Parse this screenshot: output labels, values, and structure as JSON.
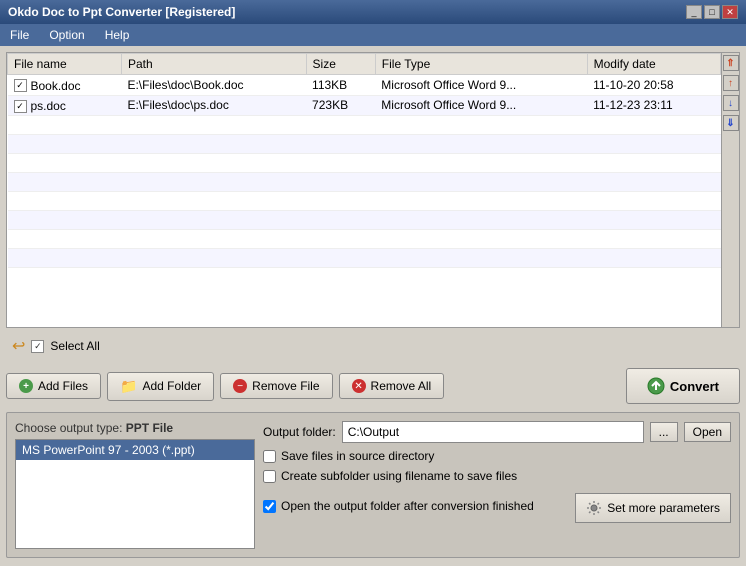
{
  "window": {
    "title": "Okdo Doc to Ppt Converter [Registered]",
    "controls": [
      "minimize",
      "maximize",
      "close"
    ]
  },
  "menubar": {
    "items": [
      "File",
      "Option",
      "Help"
    ]
  },
  "file_table": {
    "columns": [
      "File name",
      "Path",
      "Size",
      "File Type",
      "Modify date"
    ],
    "rows": [
      {
        "checked": true,
        "name": "Book.doc",
        "path": "E:\\Files\\doc\\Book.doc",
        "size": "113KB",
        "type": "Microsoft Office Word 9...",
        "modified": "11-10-20 20:58"
      },
      {
        "checked": true,
        "name": "ps.doc",
        "path": "E:\\Files\\doc\\ps.doc",
        "size": "723KB",
        "type": "Microsoft Office Word 9...",
        "modified": "11-12-23 23:11"
      }
    ]
  },
  "select_all": {
    "label": "Select All"
  },
  "toolbar": {
    "add_files": "Add Files",
    "add_folder": "Add Folder",
    "remove_file": "Remove File",
    "remove_all": "Remove All",
    "convert": "Convert"
  },
  "output_type": {
    "label": "Choose output type:",
    "current": "PPT File",
    "options": [
      "MS PowerPoint 97 - 2003 (*.ppt)"
    ]
  },
  "output_folder": {
    "label": "Output folder:",
    "value": "C:\\Output",
    "browse_label": "...",
    "open_label": "Open"
  },
  "checkboxes": [
    {
      "id": "cb1",
      "checked": false,
      "label": "Save files in source directory"
    },
    {
      "id": "cb2",
      "checked": false,
      "label": "Create subfolder using filename to save files"
    },
    {
      "id": "cb3",
      "checked": true,
      "label": "Open the output folder after conversion finished"
    }
  ],
  "set_params": {
    "label": "Set more parameters"
  },
  "scrollbar": {
    "up_top": "⇑",
    "up": "↑",
    "down": "↓",
    "down_bottom": "⇓"
  }
}
